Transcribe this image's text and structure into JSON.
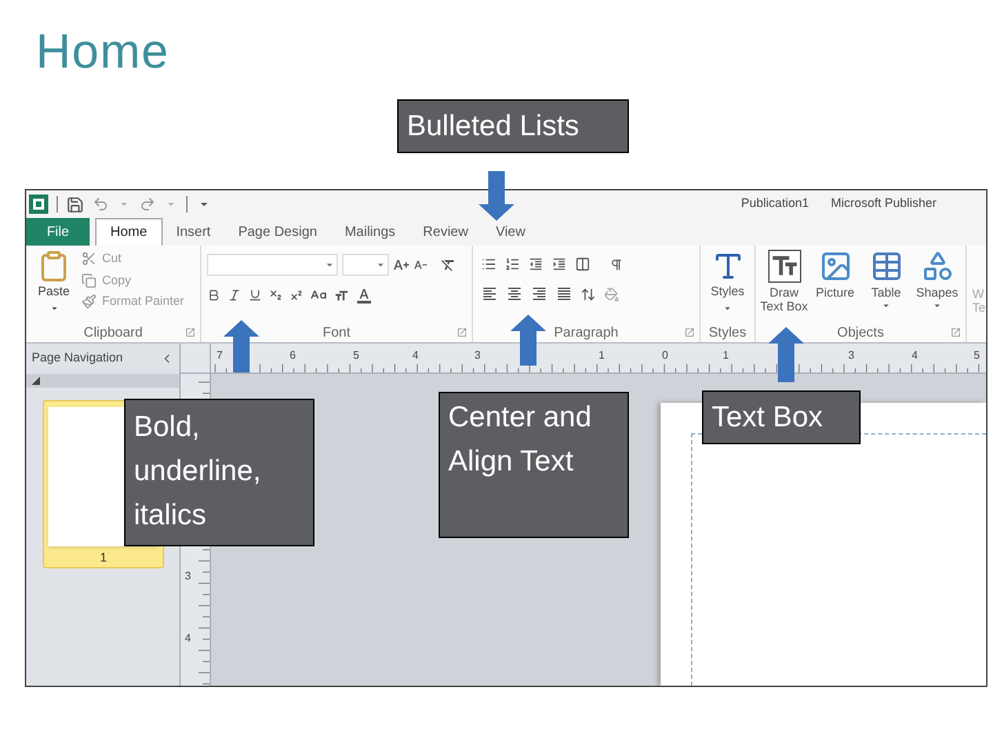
{
  "slide": {
    "title": "Home"
  },
  "app": {
    "document": "Publication1",
    "app_name": "Microsoft Publisher",
    "tabs": [
      {
        "label": "File",
        "kind": "file"
      },
      {
        "label": "Home",
        "kind": "tab",
        "selected": true
      },
      {
        "label": "Insert",
        "kind": "tab",
        "selected": false
      },
      {
        "label": "Page Design",
        "kind": "tab",
        "selected": false
      },
      {
        "label": "Mailings",
        "kind": "tab",
        "selected": false
      },
      {
        "label": "Review",
        "kind": "tab",
        "selected": false
      },
      {
        "label": "View",
        "kind": "tab",
        "selected": false
      }
    ],
    "clipboard": {
      "label": "Clipboard",
      "paste": "Paste",
      "cut": "Cut",
      "copy": "Copy",
      "format_painter": "Format Painter"
    },
    "font": {
      "label": "Font"
    },
    "paragraph": {
      "label": "Paragraph"
    },
    "styles": {
      "label": "Styles",
      "button": "Styles"
    },
    "objects": {
      "label": "Objects",
      "buttons": [
        {
          "label": "Draw Text Box",
          "kind": "textbox"
        },
        {
          "label": "Picture",
          "kind": "picture"
        },
        {
          "label": "Table",
          "kind": "table"
        },
        {
          "label": "Shapes",
          "kind": "shapes"
        }
      ]
    },
    "cut_group": {
      "lines": [
        "W",
        "Te"
      ]
    },
    "navigation": {
      "title": "Page Navigation",
      "pages": [
        {
          "number": "1",
          "selected": true
        }
      ]
    },
    "ruler": {
      "horizontal": [
        "7",
        "6",
        "5",
        "4",
        "3",
        "1",
        "0",
        "1",
        "3",
        "4",
        "5"
      ],
      "vertical": [
        "3",
        "4"
      ]
    }
  },
  "callouts": [
    {
      "text": "Bulleted Lists"
    },
    {
      "text": "Bold, underline, italics"
    },
    {
      "text": "Center and Align Text"
    },
    {
      "text": "Text Box"
    }
  ]
}
